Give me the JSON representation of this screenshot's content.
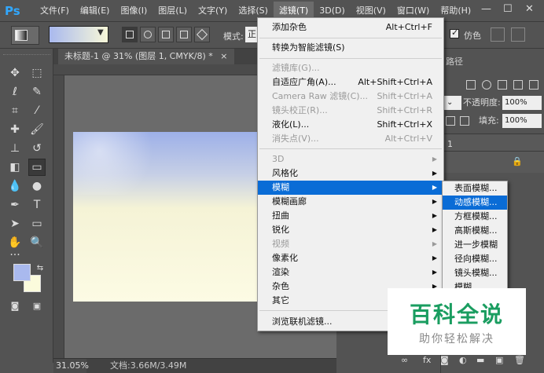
{
  "app": {
    "logo": "Ps"
  },
  "menubar": {
    "items": [
      "文件(F)",
      "编辑(E)",
      "图像(I)",
      "图层(L)",
      "文字(Y)",
      "选择(S)",
      "滤镜(T)",
      "3D(D)",
      "视图(V)",
      "窗口(W)",
      "帮助(H)"
    ],
    "active_index": 6
  },
  "options": {
    "mode_label": "模式:",
    "mode_value": "正",
    "dither_label": "仿色"
  },
  "document": {
    "tab_title": "未标题-1 @ 31% (图层 1, CMYK/8) *",
    "close": "×",
    "zoom": "31.05%",
    "doc_size": "文档:3.66M/3.49M"
  },
  "right_panel": {
    "tab": "路径",
    "opacity_label": "不透明度:",
    "opacity_value": "100%",
    "fill_label": "填充:",
    "fill_value": "100%",
    "layer_item": "1"
  },
  "filter_menu": {
    "items": [
      {
        "label": "添加杂色",
        "shortcut": "Alt+Ctrl+F",
        "disabled": false
      },
      {
        "label": "转换为智能滤镜(S)",
        "shortcut": "",
        "disabled": false
      },
      {
        "label": "滤镜库(G)...",
        "shortcut": "",
        "disabled": true
      },
      {
        "label": "自适应广角(A)...",
        "shortcut": "Alt+Shift+Ctrl+A",
        "disabled": false
      },
      {
        "label": "Camera Raw 滤镜(C)...",
        "shortcut": "Shift+Ctrl+A",
        "disabled": true
      },
      {
        "label": "镜头校正(R)...",
        "shortcut": "Shift+Ctrl+R",
        "disabled": true
      },
      {
        "label": "液化(L)...",
        "shortcut": "Shift+Ctrl+X",
        "disabled": false
      },
      {
        "label": "消失点(V)...",
        "shortcut": "Alt+Ctrl+V",
        "disabled": true
      },
      {
        "label": "3D",
        "disabled": true,
        "submenu": true
      },
      {
        "label": "风格化",
        "disabled": false,
        "submenu": true
      },
      {
        "label": "模糊",
        "disabled": false,
        "submenu": true,
        "highlighted": true
      },
      {
        "label": "模糊画廊",
        "disabled": false,
        "submenu": true
      },
      {
        "label": "扭曲",
        "disabled": false,
        "submenu": true
      },
      {
        "label": "锐化",
        "disabled": false,
        "submenu": true
      },
      {
        "label": "视频",
        "disabled": true,
        "submenu": true
      },
      {
        "label": "像素化",
        "disabled": false,
        "submenu": true
      },
      {
        "label": "渲染",
        "disabled": false,
        "submenu": true
      },
      {
        "label": "杂色",
        "disabled": false,
        "submenu": true
      },
      {
        "label": "其它",
        "disabled": false,
        "submenu": true
      },
      {
        "label": "浏览联机滤镜...",
        "disabled": false
      }
    ]
  },
  "blur_submenu": {
    "items": [
      "表面模糊...",
      "动感模糊...",
      "方框模糊...",
      "高斯模糊...",
      "进一步模糊",
      "径向模糊...",
      "镜头模糊...",
      "模糊"
    ],
    "highlighted_index": 1
  },
  "colors": {
    "foreground": "#a9b9ee",
    "background": "#fbfbdc",
    "highlight": "#0a6cd6",
    "watermark": "#1a9d60"
  },
  "watermark": {
    "title": "百科全说",
    "subtitle": "助你轻松解决"
  }
}
